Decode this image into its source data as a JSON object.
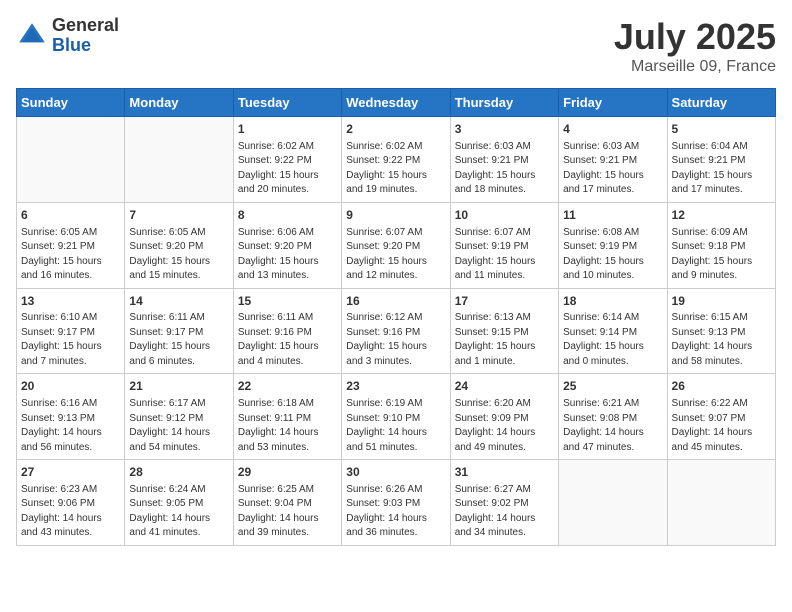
{
  "header": {
    "logo_general": "General",
    "logo_blue": "Blue",
    "title": "July 2025",
    "location": "Marseille 09, France"
  },
  "weekdays": [
    "Sunday",
    "Monday",
    "Tuesday",
    "Wednesday",
    "Thursday",
    "Friday",
    "Saturday"
  ],
  "weeks": [
    [
      {
        "day": "",
        "info": ""
      },
      {
        "day": "",
        "info": ""
      },
      {
        "day": "1",
        "info": "Sunrise: 6:02 AM\nSunset: 9:22 PM\nDaylight: 15 hours and 20 minutes."
      },
      {
        "day": "2",
        "info": "Sunrise: 6:02 AM\nSunset: 9:22 PM\nDaylight: 15 hours and 19 minutes."
      },
      {
        "day": "3",
        "info": "Sunrise: 6:03 AM\nSunset: 9:21 PM\nDaylight: 15 hours and 18 minutes."
      },
      {
        "day": "4",
        "info": "Sunrise: 6:03 AM\nSunset: 9:21 PM\nDaylight: 15 hours and 17 minutes."
      },
      {
        "day": "5",
        "info": "Sunrise: 6:04 AM\nSunset: 9:21 PM\nDaylight: 15 hours and 17 minutes."
      }
    ],
    [
      {
        "day": "6",
        "info": "Sunrise: 6:05 AM\nSunset: 9:21 PM\nDaylight: 15 hours and 16 minutes."
      },
      {
        "day": "7",
        "info": "Sunrise: 6:05 AM\nSunset: 9:20 PM\nDaylight: 15 hours and 15 minutes."
      },
      {
        "day": "8",
        "info": "Sunrise: 6:06 AM\nSunset: 9:20 PM\nDaylight: 15 hours and 13 minutes."
      },
      {
        "day": "9",
        "info": "Sunrise: 6:07 AM\nSunset: 9:20 PM\nDaylight: 15 hours and 12 minutes."
      },
      {
        "day": "10",
        "info": "Sunrise: 6:07 AM\nSunset: 9:19 PM\nDaylight: 15 hours and 11 minutes."
      },
      {
        "day": "11",
        "info": "Sunrise: 6:08 AM\nSunset: 9:19 PM\nDaylight: 15 hours and 10 minutes."
      },
      {
        "day": "12",
        "info": "Sunrise: 6:09 AM\nSunset: 9:18 PM\nDaylight: 15 hours and 9 minutes."
      }
    ],
    [
      {
        "day": "13",
        "info": "Sunrise: 6:10 AM\nSunset: 9:17 PM\nDaylight: 15 hours and 7 minutes."
      },
      {
        "day": "14",
        "info": "Sunrise: 6:11 AM\nSunset: 9:17 PM\nDaylight: 15 hours and 6 minutes."
      },
      {
        "day": "15",
        "info": "Sunrise: 6:11 AM\nSunset: 9:16 PM\nDaylight: 15 hours and 4 minutes."
      },
      {
        "day": "16",
        "info": "Sunrise: 6:12 AM\nSunset: 9:16 PM\nDaylight: 15 hours and 3 minutes."
      },
      {
        "day": "17",
        "info": "Sunrise: 6:13 AM\nSunset: 9:15 PM\nDaylight: 15 hours and 1 minute."
      },
      {
        "day": "18",
        "info": "Sunrise: 6:14 AM\nSunset: 9:14 PM\nDaylight: 15 hours and 0 minutes."
      },
      {
        "day": "19",
        "info": "Sunrise: 6:15 AM\nSunset: 9:13 PM\nDaylight: 14 hours and 58 minutes."
      }
    ],
    [
      {
        "day": "20",
        "info": "Sunrise: 6:16 AM\nSunset: 9:13 PM\nDaylight: 14 hours and 56 minutes."
      },
      {
        "day": "21",
        "info": "Sunrise: 6:17 AM\nSunset: 9:12 PM\nDaylight: 14 hours and 54 minutes."
      },
      {
        "day": "22",
        "info": "Sunrise: 6:18 AM\nSunset: 9:11 PM\nDaylight: 14 hours and 53 minutes."
      },
      {
        "day": "23",
        "info": "Sunrise: 6:19 AM\nSunset: 9:10 PM\nDaylight: 14 hours and 51 minutes."
      },
      {
        "day": "24",
        "info": "Sunrise: 6:20 AM\nSunset: 9:09 PM\nDaylight: 14 hours and 49 minutes."
      },
      {
        "day": "25",
        "info": "Sunrise: 6:21 AM\nSunset: 9:08 PM\nDaylight: 14 hours and 47 minutes."
      },
      {
        "day": "26",
        "info": "Sunrise: 6:22 AM\nSunset: 9:07 PM\nDaylight: 14 hours and 45 minutes."
      }
    ],
    [
      {
        "day": "27",
        "info": "Sunrise: 6:23 AM\nSunset: 9:06 PM\nDaylight: 14 hours and 43 minutes."
      },
      {
        "day": "28",
        "info": "Sunrise: 6:24 AM\nSunset: 9:05 PM\nDaylight: 14 hours and 41 minutes."
      },
      {
        "day": "29",
        "info": "Sunrise: 6:25 AM\nSunset: 9:04 PM\nDaylight: 14 hours and 39 minutes."
      },
      {
        "day": "30",
        "info": "Sunrise: 6:26 AM\nSunset: 9:03 PM\nDaylight: 14 hours and 36 minutes."
      },
      {
        "day": "31",
        "info": "Sunrise: 6:27 AM\nSunset: 9:02 PM\nDaylight: 14 hours and 34 minutes."
      },
      {
        "day": "",
        "info": ""
      },
      {
        "day": "",
        "info": ""
      }
    ]
  ]
}
